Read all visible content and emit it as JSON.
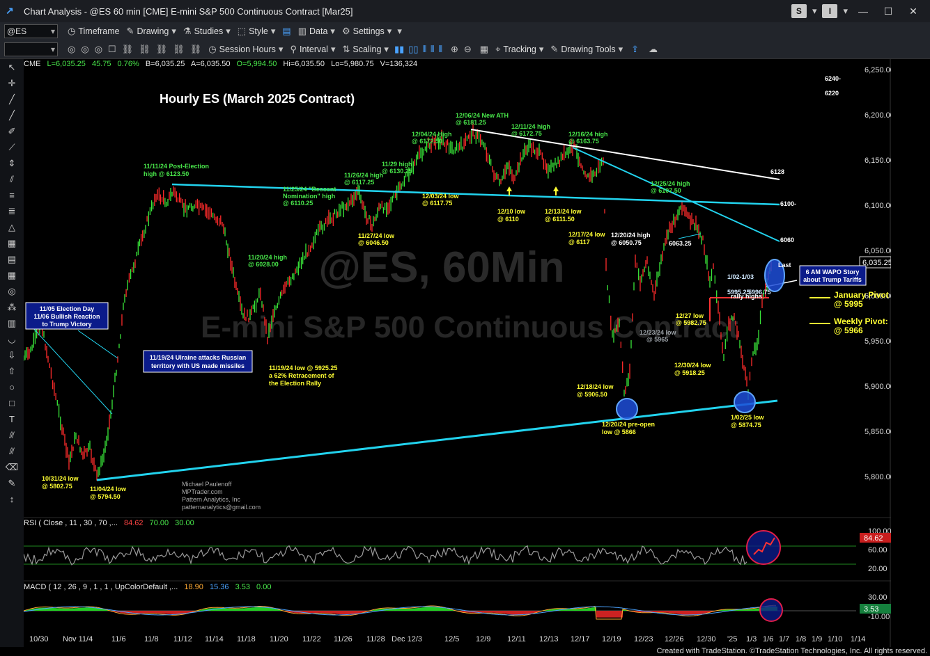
{
  "window": {
    "title": "Chart Analysis - @ES 60 min [CME] E-mini S&P 500 Continuous Contract [Mar25]",
    "btn_s": "S",
    "btn_i": "I"
  },
  "toolbar1": {
    "symbol": "@ES",
    "timeframe": "Timeframe",
    "drawing": "Drawing",
    "studies": "Studies",
    "style": "Style",
    "data": "Data",
    "settings": "Settings"
  },
  "toolbar2": {
    "session_hours": "Session Hours",
    "interval": "Interval",
    "scaling": "Scaling",
    "tracking": "Tracking",
    "drawing_tools": "Drawing Tools"
  },
  "quote": {
    "exchange": "CME",
    "last": "L=6,035.25",
    "change": "45.75",
    "pct": "0.76%",
    "bid": "B=6,035.25",
    "ask": "A=6,035.50",
    "open": "O=5,994.50",
    "high": "Hi=6,035.50",
    "low": "Lo=5,980.75",
    "volume": "V=136,324"
  },
  "chart_title": "Hourly ES (March 2025 Contract)",
  "watermark1": "@ES, 60Min",
  "watermark2": "E-mini S&P 500 Continuous Contract",
  "price_axis": [
    "6,250.00",
    "6,200.00",
    "6,150.00",
    "6,100.00",
    "6,050.00",
    "6,000.00",
    "5,950.00",
    "5,900.00",
    "5,850.00",
    "5,800.00"
  ],
  "last_price_tag": "6,035.25",
  "date_axis": [
    "10/30",
    "Nov 11/4",
    "11/6",
    "11/8",
    "11/12",
    "11/14",
    "11/18",
    "11/20",
    "11/22",
    "11/26",
    "11/28",
    "Dec 12/3",
    "12/5",
    "12/9",
    "12/11",
    "12/13",
    "12/17",
    "12/19",
    "12/23",
    "12/26",
    "12/30",
    "'25",
    "1/3",
    "1/6",
    "1/7",
    "1/8",
    "1/9",
    "1/10",
    "1/14"
  ],
  "annotations": {
    "a_1111": "11/11/24 Post-Election",
    "a_1111b": "high @ 6123.50",
    "a_1206": "12/06/24 New ATH",
    "a_1206b": "@ 6181.25",
    "a_1204": "12/04/24 High",
    "a_1204b": "@ 6172.50",
    "a_1211": "12/11/24 high",
    "a_1211b": "@ 6172.75",
    "a_1216": "12/16/24 high",
    "a_1216b": "@ 6163.75",
    "a_1126": "11/26/24 high",
    "a_1126b": "@ 6117.25",
    "a_1129": "11/29 high",
    "a_1129b": "@ 6130.25",
    "a_1125": "11/25/24 \"Bessent",
    "a_1125b": "Nomination\" high",
    "a_1125c": "@ 6110.25",
    "a_1203": "12/03/24 low",
    "a_1203b": "@ 6117.75",
    "a_1210": "12/10 low",
    "a_1210b": "@ 6110",
    "a_1213": "12/13/24 low",
    "a_1213b": "@ 6111.50",
    "a_1127": "11/27/24 low",
    "a_1127b": "@ 6046.50",
    "a_1225": "12/25/24 high",
    "a_1225b": "@ 6107.50",
    "a_1217": "12/17/24 low",
    "a_1217b": "@ 6117",
    "a_1220": "12/20/24 high",
    "a_1220b": "@ 6050.75",
    "a_6063": "6063.25",
    "a_1120": "11/20/24 high",
    "a_1120b": "@ 6028.00",
    "a_1102": "1/02-1/03",
    "a_1102b": "rally highs",
    "a_5995": "5995.25",
    "a_5996": "5996.75",
    "a_1227": "12/27 low",
    "a_1227b": "@ 5982.75",
    "a_1223": "12/23/24 low",
    "a_1223b": "@ 5965",
    "a_1119": "11/19/24 low @ 5925.25",
    "a_1119b": "a 62% Retracement of",
    "a_1119c": "the Election Rally",
    "a_1230": "12/30/24 low",
    "a_1230b": "@ 5918.25",
    "a_1218": "12/18/24 low",
    "a_1218b": "@ 5906.50",
    "a_1220pre": "12/20/24 pre-open",
    "a_1220preb": "low @ 5866",
    "a_0102": "1/02/25 low",
    "a_0102b": "@ 5874.75",
    "a_1031": "10/31/24 low",
    "a_1031b": "@ 5802.75",
    "a_1104": "11/04/24 low",
    "a_1104b": "@ 5794.50",
    "author1": "Michael Paulenoff",
    "author2": "MPTrader.com",
    "author3": "Pattern Analytics, Inc",
    "author4": "patternanalytics@gmail.com",
    "last": "Last",
    "lvl_6240": "6240-",
    "lvl_6220": "6220",
    "lvl_6128": "6128",
    "lvl_6100": "6100-",
    "lvl_6060": "6060",
    "jan_pivot": "January Pivot",
    "jan_pivot_b": "@ 5995",
    "wk_pivot": "Weekly Pivot:",
    "wk_pivot_b": "@ 5966"
  },
  "boxes": {
    "election1": "11/05 Election Day",
    "election2": "11/06 Bullish Reaction",
    "election3": "to Trump Victory",
    "ukraine1": "11/19/24 Ulraine attacks Russian",
    "ukraine2": "territory with US made missiles",
    "wapo1": "6 AM WAPO Story",
    "wapo2": "about Trump Tariffs"
  },
  "rsi": {
    "label": "RSI ( Close , 11 , 30 , 70 ,...",
    "v1": "84.62",
    "v2": "70.00",
    "v3": "30.00",
    "axis": [
      "100.00",
      "60.00",
      "20.00"
    ],
    "tag": "84.62"
  },
  "macd": {
    "label": "MACD ( 12 , 26 , 9 , 1 , 1 , UpColorDefault ,...",
    "v1": "18.90",
    "v2": "15.36",
    "v3": "3.53",
    "v4": "0.00",
    "axis": [
      "30.00",
      "-10.00"
    ],
    "tag": "3.53"
  },
  "credit": "Created with TradeStation. ©TradeStation Technologies, Inc. All rights reserved."
}
